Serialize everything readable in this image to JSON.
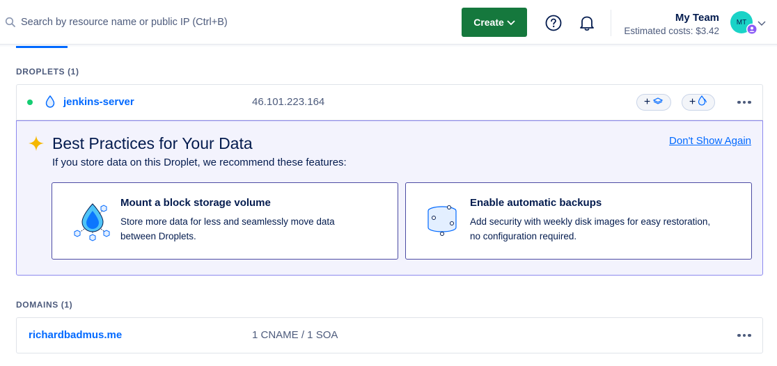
{
  "search": {
    "placeholder": "Search by resource name or public IP (Ctrl+B)"
  },
  "header": {
    "create_label": "Create",
    "team_name": "My Team",
    "estimated_costs": "Estimated costs: $3.42",
    "avatar_initials": "MT"
  },
  "droplets": {
    "section_label": "DROPLETS (1)",
    "items": [
      {
        "name": "jenkins-server",
        "ip": "46.101.223.164",
        "status_color": "#15cd72"
      }
    ]
  },
  "best_practices": {
    "title": "Best Practices for Your Data",
    "subtitle": "If you store data on this Droplet, we recommend these features:",
    "dismiss_label": "Don't Show Again",
    "features": [
      {
        "title": "Mount a block storage volume",
        "description": "Store more data for less and seamlessly move data between Droplets."
      },
      {
        "title": "Enable automatic backups",
        "description": "Add security with weekly disk images for easy restoration, no configuration required."
      }
    ]
  },
  "domains": {
    "section_label": "DOMAINS (1)",
    "items": [
      {
        "name": "richardbadmus.me",
        "records": "1 CNAME / 1 SOA"
      }
    ]
  },
  "colors": {
    "accent": "#0069ff",
    "create_button": "#15783d",
    "status_active": "#15cd72",
    "panel_border": "#8c88ee"
  }
}
